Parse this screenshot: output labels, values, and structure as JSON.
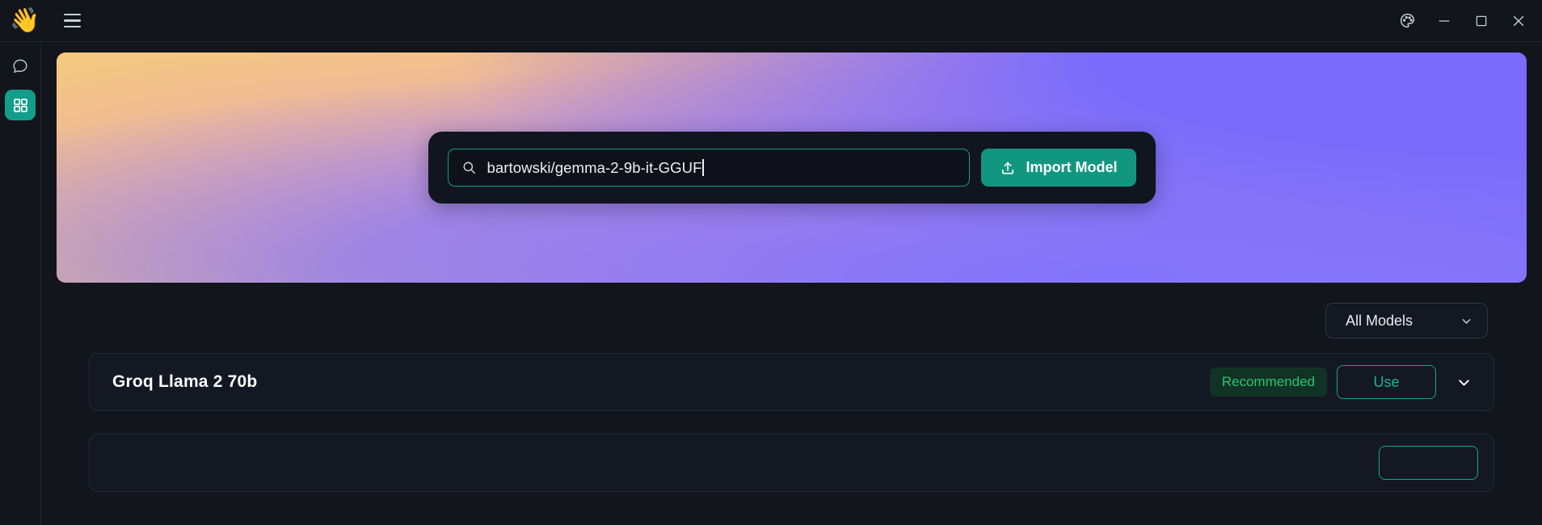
{
  "titlebar": {
    "logo": "waving-hand",
    "menu_icon": "hamburger-menu-icon",
    "theme_icon": "palette-icon",
    "minimize_icon": "minimize-icon",
    "maximize_icon": "maximize-icon",
    "close_icon": "close-icon"
  },
  "sidebar": {
    "items": [
      {
        "id": "chat",
        "icon": "chat-bubble-icon",
        "active": false
      },
      {
        "id": "models",
        "icon": "grid-apps-icon",
        "active": true
      }
    ]
  },
  "banner": {
    "gradient_from": "#F7D073",
    "gradient_mid": "#E9A9B6",
    "gradient_to": "#7B6BFB"
  },
  "search": {
    "icon": "search-icon",
    "value": "bartowski/gemma-2-9b-it-GGUF",
    "placeholder": "Search models",
    "border_color": "#139E8B"
  },
  "import_button": {
    "label": "Import Model",
    "icon": "upload-icon",
    "color": "#11977F"
  },
  "filter": {
    "label": "All Models",
    "icon": "chevron-down-icon"
  },
  "models": [
    {
      "name": "Groq Llama 2 70b",
      "badge": "Recommended",
      "badge_color": "#2EC26E",
      "use_label": "Use",
      "expand_icon": "chevron-down-icon"
    }
  ]
}
